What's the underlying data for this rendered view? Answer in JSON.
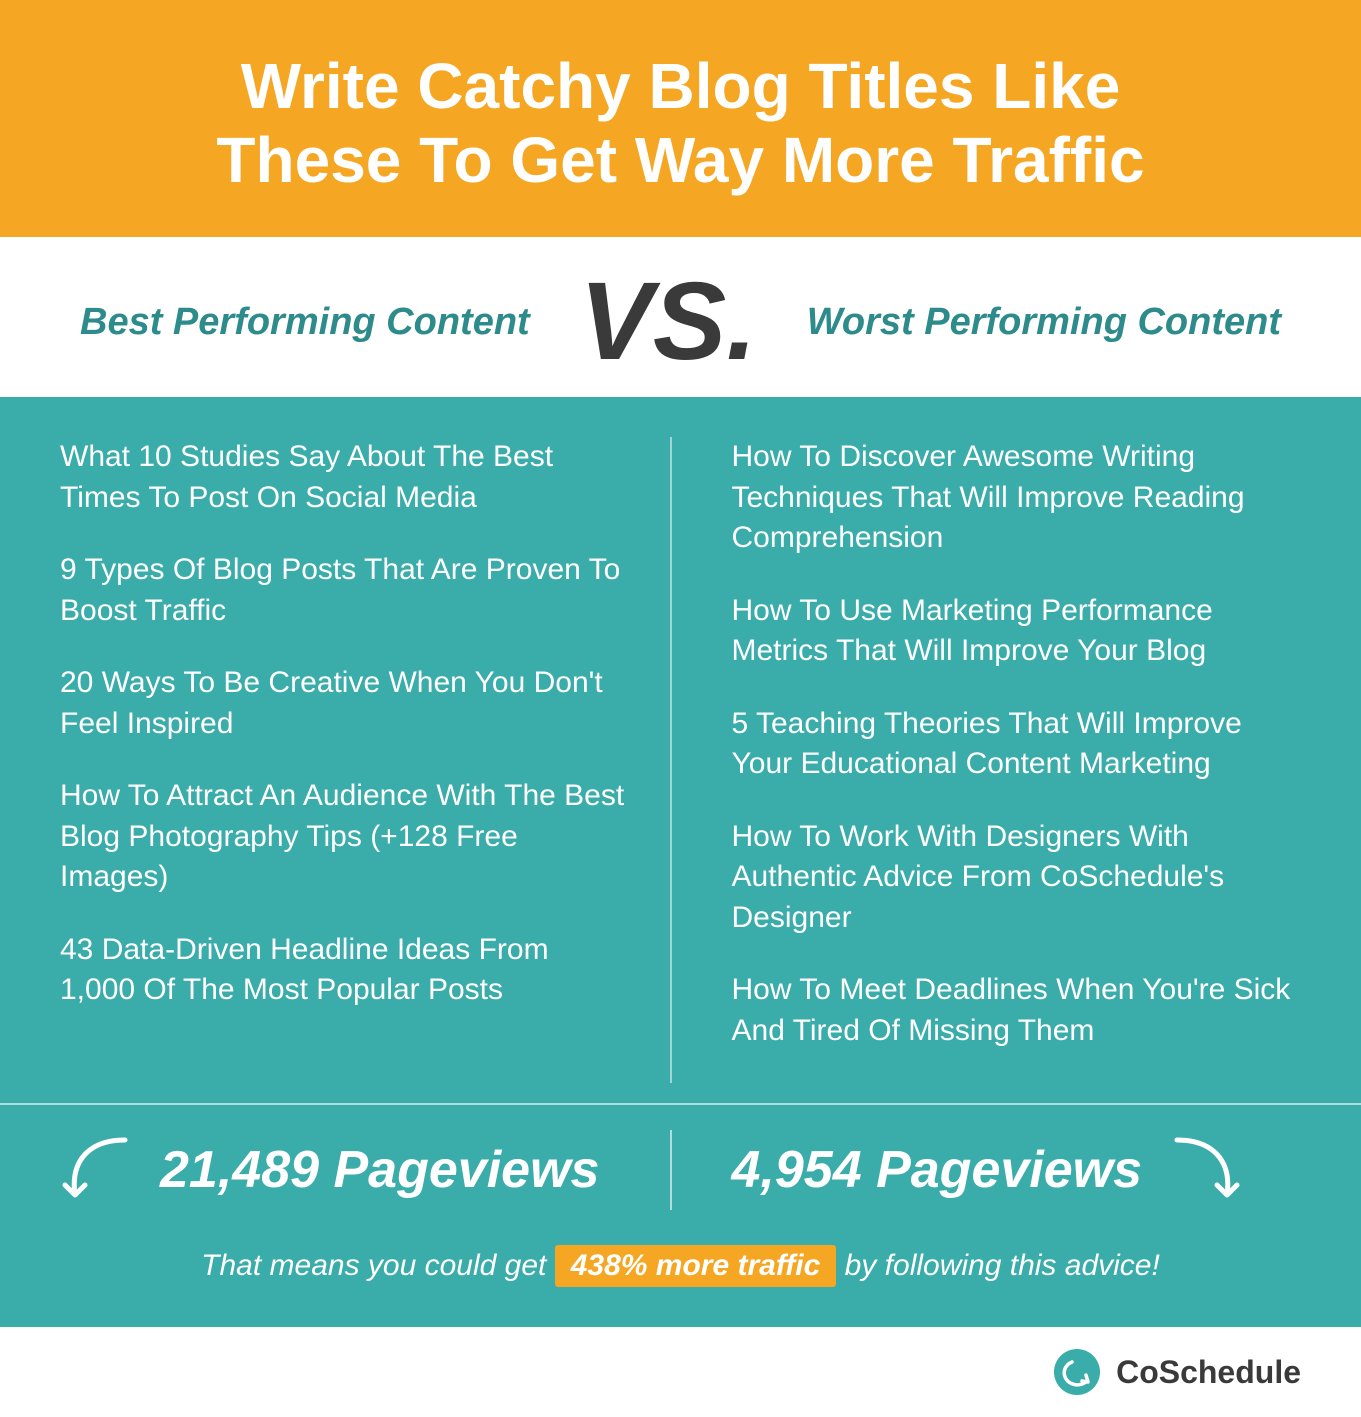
{
  "header": {
    "title_line1": "Write Catchy Blog Titles Like",
    "title_line2": "These To Get Way More Traffic"
  },
  "vs_section": {
    "best_label": "Best Performing Content",
    "vs_text": "VS.",
    "worst_label": "Worst Performing Content"
  },
  "best_content": {
    "items": [
      "What 10 Studies Say About The Best Times To Post On Social Media",
      "9 Types Of Blog Posts That Are Proven To Boost Traffic",
      "20 Ways To Be Creative When You Don't Feel Inspired",
      "How To Attract An Audience With The Best Blog Photography Tips (+128 Free Images)",
      "43 Data-Driven Headline Ideas From 1,000 Of The Most Popular Posts"
    ]
  },
  "worst_content": {
    "items": [
      "How To Discover Awesome Writing Techniques That Will Improve Reading Comprehension",
      "How To Use Marketing Performance Metrics That Will Improve Your Blog",
      "5 Teaching Theories That Will Improve Your Educational Content Marketing",
      "How To Work With Designers With Authentic Advice From CoSchedule's Designer",
      "How To Meet Deadlines When You're Sick And Tired Of Missing Them"
    ]
  },
  "stats": {
    "best_pageviews": "21,489 Pageviews",
    "worst_pageviews": "4,954 Pageviews"
  },
  "tagline": {
    "before": "That means you could get",
    "highlight": "438% more traffic",
    "after": "by following this advice!"
  },
  "branding": {
    "name": "CoSchedule"
  }
}
